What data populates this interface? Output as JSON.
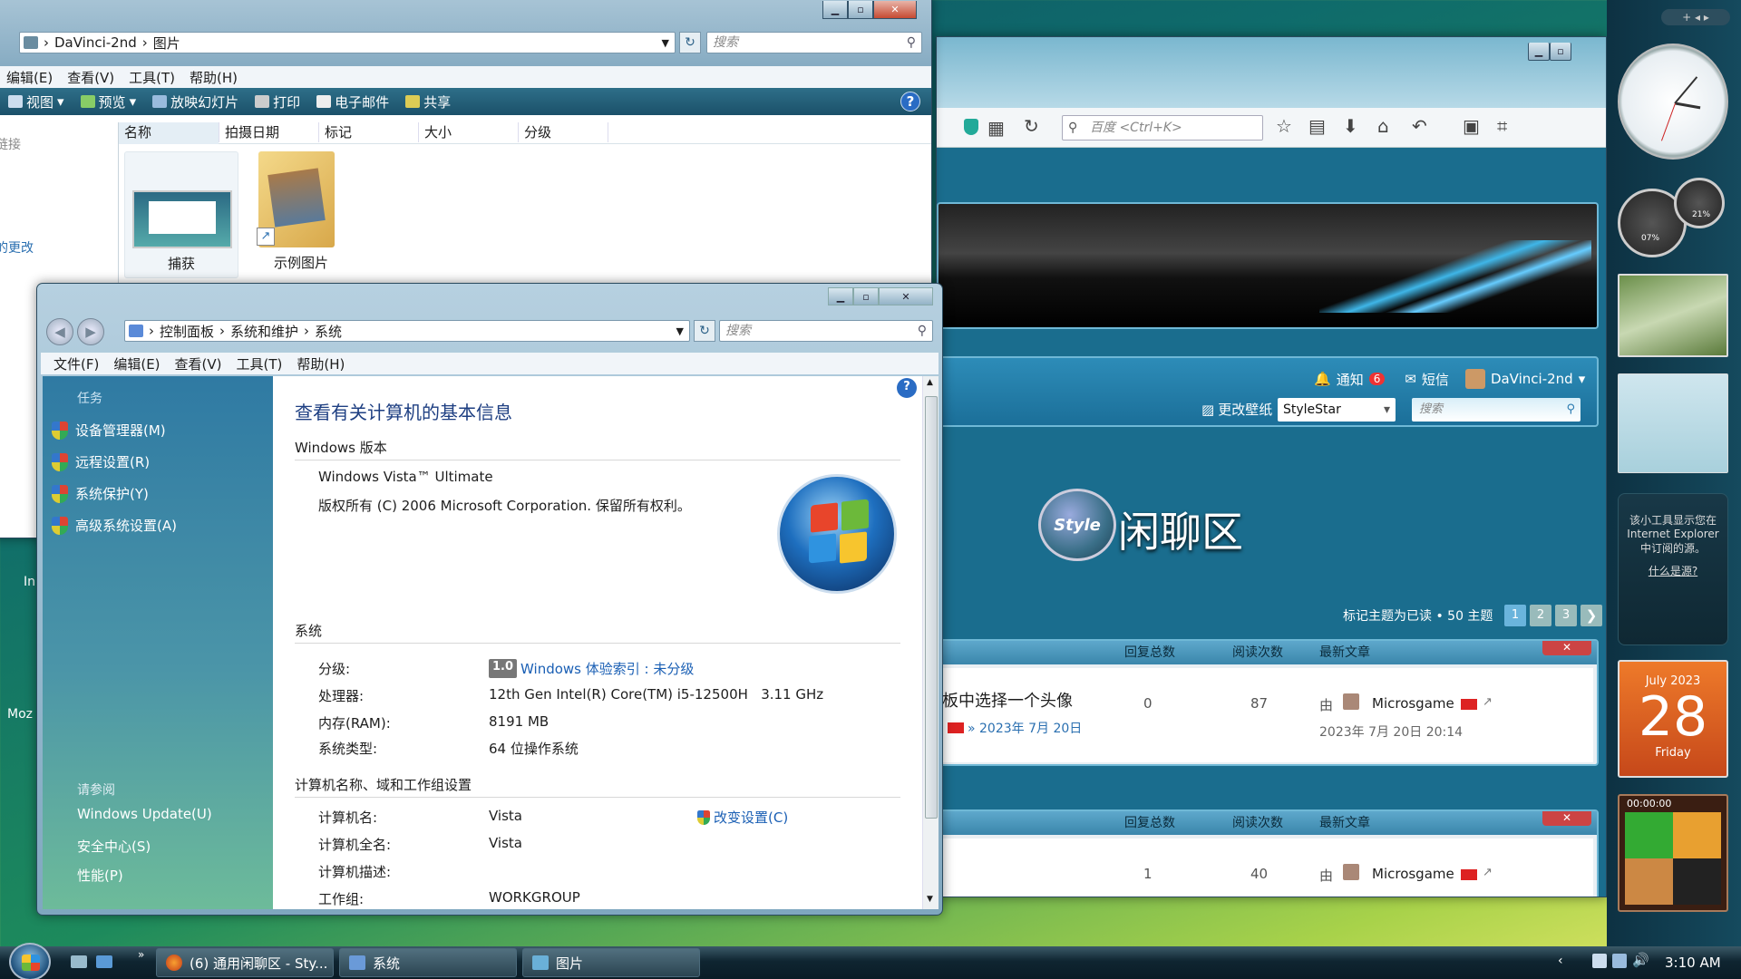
{
  "explorer": {
    "crumb_computer": "DaVinci-2nd",
    "crumb_folder": "图片",
    "search": "搜索",
    "menu": [
      "编辑(E)",
      "查看(V)",
      "工具(T)",
      "帮助(H)"
    ],
    "toolbar": [
      "视图",
      "预览",
      "放映幻灯片",
      "打印",
      "电子邮件",
      "共享"
    ],
    "columns": [
      "名称",
      "拍摄日期",
      "标记",
      "大小",
      "分级"
    ],
    "items": [
      "捕获",
      "示例图片"
    ],
    "left_fragments": [
      "链接",
      "的更改",
      "In",
      "Moz"
    ]
  },
  "system": {
    "crumbs": [
      "控制面板",
      "系统和维护",
      "系统"
    ],
    "search": "搜索",
    "menu": [
      "文件(F)",
      "编辑(E)",
      "查看(V)",
      "工具(T)",
      "帮助(H)"
    ],
    "tasks_title": "任务",
    "tasks": [
      "设备管理器(M)",
      "远程设置(R)",
      "系统保护(Y)",
      "高级系统设置(A)"
    ],
    "see_also_title": "请参阅",
    "see_also": [
      "Windows Update(U)",
      "安全中心(S)",
      "性能(P)"
    ],
    "heading": "查看有关计算机的基本信息",
    "edition_section": "Windows 版本",
    "edition": "Windows Vista™ Ultimate",
    "copyright": "版权所有 (C) 2006 Microsoft Corporation. 保留所有权利。",
    "system_section": "系统",
    "rating_label": "分级:",
    "rating_score": "1.0",
    "rating_link": "Windows 体验索引 : 未分级",
    "processor_label": "处理器:",
    "processor": "12th Gen Intel(R) Core(TM) i5-12500H   3.11 GHz",
    "ram_label": "内存(RAM):",
    "ram": "8191 MB",
    "type_label": "系统类型:",
    "type": "64 位操作系统",
    "name_section": "计算机名称、域和工作组设置",
    "name_label": "计算机名:",
    "name": "Vista",
    "change": "改变设置(C)",
    "fullname_label": "计算机全名:",
    "fullname": "Vista",
    "desc_label": "计算机描述:",
    "desc": "",
    "wg_label": "工作组:",
    "workgroup": "WORKGROUP"
  },
  "browser": {
    "search_placeholder": "百度 <Ctrl+K>",
    "notify": "通知",
    "notify_count": "6",
    "sms": "短信",
    "user": "DaVinci-2nd",
    "wallpaper": "更改壁纸",
    "style": "StyleStar",
    "forum_search": "搜索",
    "forum_title": "闲聊区",
    "logo": "Style",
    "mark_read": "标记主题为已读 • 50 主题",
    "pages": [
      "1",
      "2",
      "3"
    ],
    "cols": [
      "回复总数",
      "阅读次数",
      "最新文章"
    ],
    "thread1": {
      "title": "板中选择一个头像",
      "date": "» 2023年 7月 20日",
      "replies": "0",
      "views": "87",
      "by": "由",
      "author": "Microsgame",
      "last": "2023年 7月 20日 20:14"
    },
    "thread2": {
      "replies": "1",
      "views": "40",
      "by": "由",
      "author": "Microsgame"
    }
  },
  "gadgets": {
    "feed_text": "该小工具显示您在 Internet Explorer 中订阅的源。",
    "feed_link": "什么是源?",
    "cal_month": "July 2023",
    "cal_day": "28",
    "cal_weekday": "Friday",
    "puzzle_time": "00:00:00",
    "meter1": "07%",
    "meter2": "21%"
  },
  "taskbar": {
    "tasks": [
      "(6) 通用闲聊区 - Sty...",
      "系统",
      "图片"
    ],
    "clock": "3:10 AM"
  }
}
